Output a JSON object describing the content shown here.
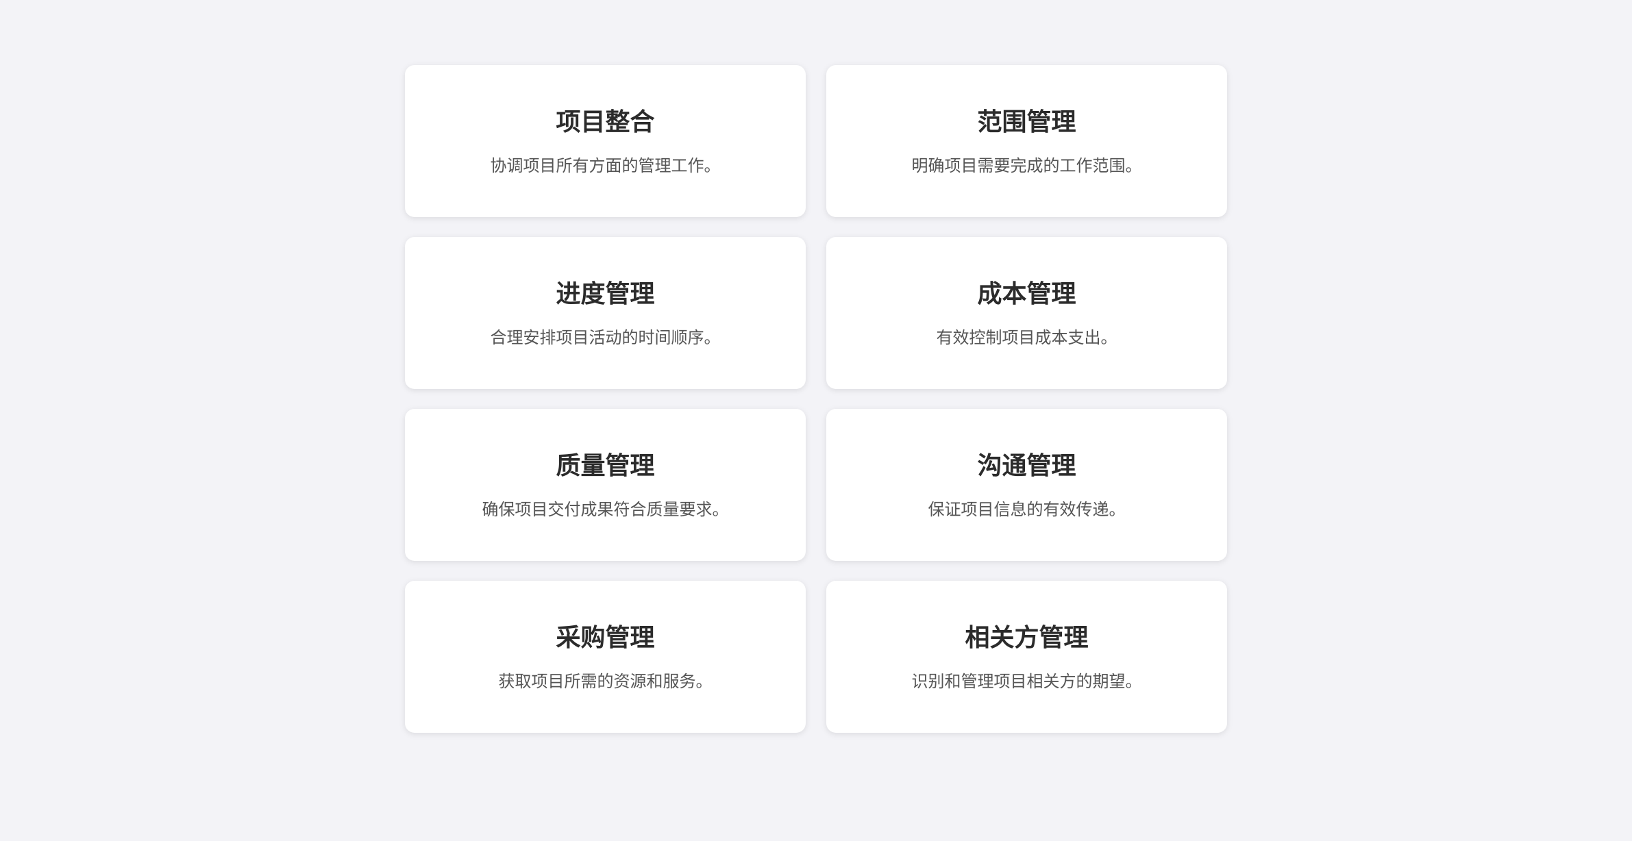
{
  "cards": [
    {
      "title": "项目整合",
      "desc": "协调项目所有方面的管理工作。"
    },
    {
      "title": "范围管理",
      "desc": "明确项目需要完成的工作范围。"
    },
    {
      "title": "进度管理",
      "desc": "合理安排项目活动的时间顺序。"
    },
    {
      "title": "成本管理",
      "desc": "有效控制项目成本支出。"
    },
    {
      "title": "质量管理",
      "desc": "确保项目交付成果符合质量要求。"
    },
    {
      "title": "沟通管理",
      "desc": "保证项目信息的有效传递。"
    },
    {
      "title": "采购管理",
      "desc": "获取项目所需的资源和服务。"
    },
    {
      "title": "相关方管理",
      "desc": "识别和管理项目相关方的期望。"
    }
  ],
  "colors": {
    "background": "#f3f3f7",
    "card": "#ffffff",
    "title": "#2b2b2b",
    "description": "#555555"
  }
}
